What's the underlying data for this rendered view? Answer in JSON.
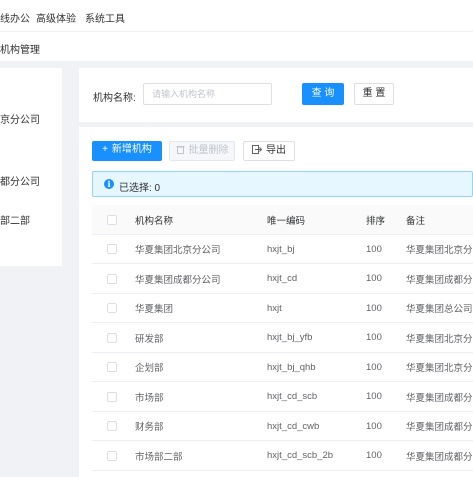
{
  "top_nav": {
    "items": [
      "线办公",
      "高级体验",
      "系统工具"
    ]
  },
  "breadcrumb": {
    "current": "机构管理"
  },
  "tree": {
    "nodes": [
      "京分公司",
      "都分公司",
      "部二部"
    ]
  },
  "search": {
    "label": "机构名称:",
    "placeholder": "请输入机构名称",
    "query_label": "查 询",
    "reset_label": "重 置"
  },
  "toolbar": {
    "add_label": "新增机构",
    "batch_delete_label": "批量删除",
    "export_label": "导出"
  },
  "selection": {
    "text": "已选择: 0"
  },
  "table": {
    "headers": [
      "机构名称",
      "唯一编码",
      "排序",
      "备注"
    ],
    "rows": [
      [
        "华夏集团北京分公司",
        "hxjt_bj",
        "100",
        "华夏集团北京分公司"
      ],
      [
        "华夏集团成都分公司",
        "hxjt_cd",
        "100",
        "华夏集团成都分公司"
      ],
      [
        "华夏集团",
        "hxjt",
        "100",
        "华夏集团总公司"
      ],
      [
        "研发部",
        "hxjt_bj_yfb",
        "100",
        "华夏集团北京分公"
      ],
      [
        "企划部",
        "hxjt_bj_qhb",
        "100",
        "华夏集团北京分公"
      ],
      [
        "市场部",
        "hxjt_cd_scb",
        "100",
        "华夏集团成都分公"
      ],
      [
        "财务部",
        "hxjt_cd_cwb",
        "100",
        "华夏集团成都分公"
      ],
      [
        "市场部二部",
        "hxjt_cd_scb_2b",
        "100",
        "华夏集团成都分公"
      ]
    ]
  },
  "colors": {
    "primary": "#1890ff",
    "alert_bg": "#e6f7ff"
  }
}
